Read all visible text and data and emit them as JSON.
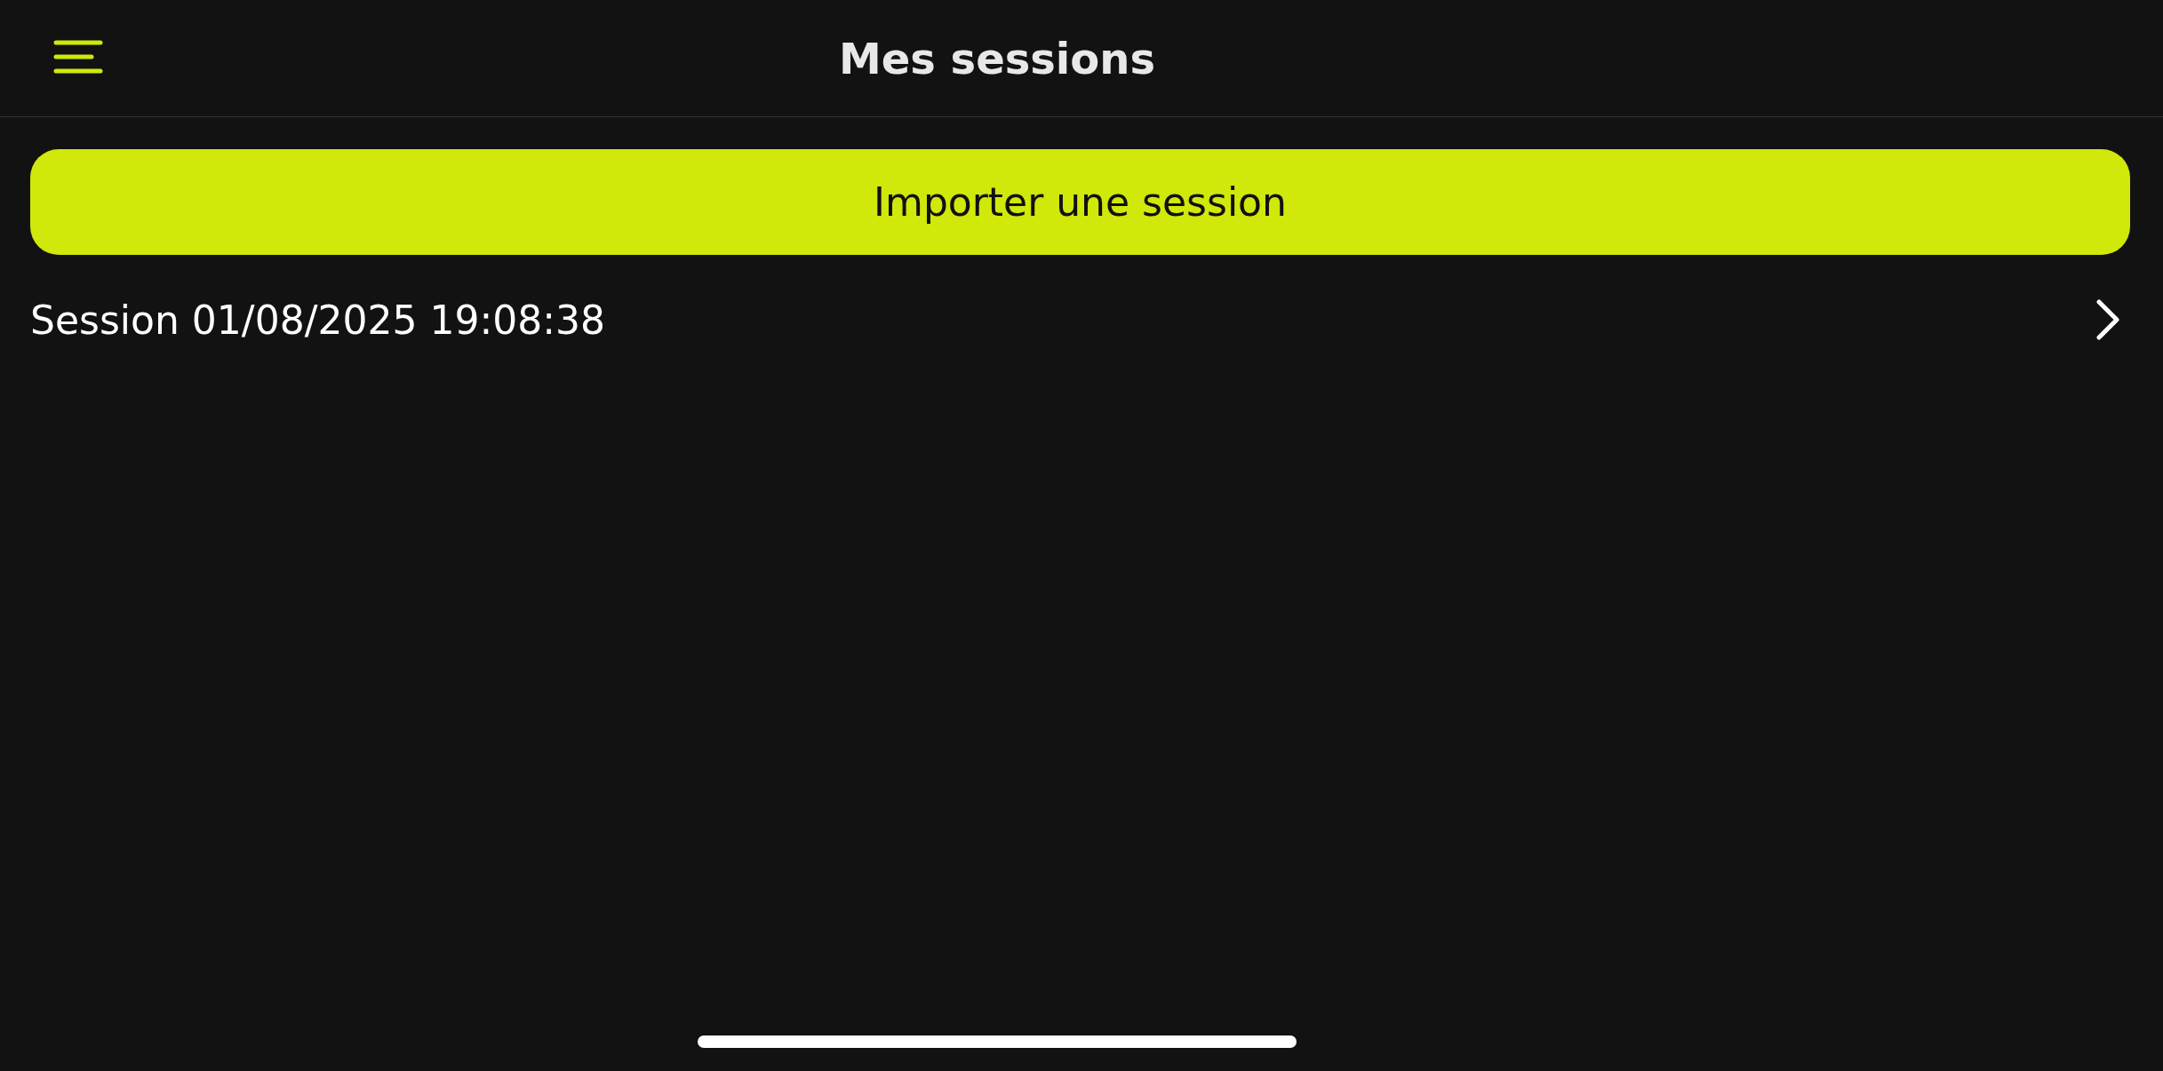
{
  "header": {
    "title": "Mes sessions"
  },
  "import_button": {
    "label": "Importer une session"
  },
  "sessions": [
    {
      "label": "Session 01/08/2025 19:08:38"
    }
  ]
}
